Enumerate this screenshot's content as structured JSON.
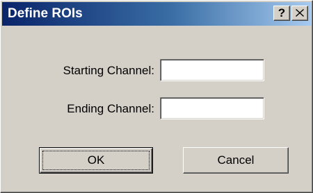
{
  "window": {
    "title": "Define ROIs",
    "help_label": "?",
    "colors": {
      "titlebar_start": "#0a246a",
      "titlebar_end": "#a6caf0",
      "face": "#d4d0c8"
    }
  },
  "fields": {
    "starting_channel": {
      "label": "Starting Channel:",
      "value": ""
    },
    "ending_channel": {
      "label": "Ending Channel:",
      "value": ""
    }
  },
  "buttons": {
    "ok_label": "OK",
    "cancel_label": "Cancel"
  },
  "icons": {
    "help": "question-mark-icon",
    "close": "close-icon"
  }
}
